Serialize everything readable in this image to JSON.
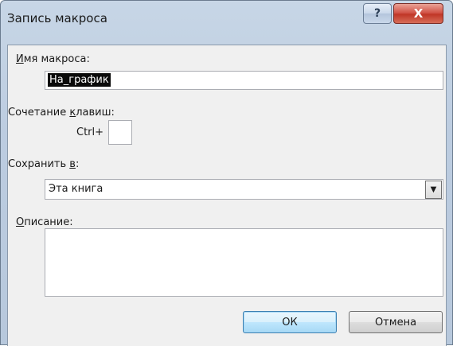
{
  "window": {
    "title": "Запись макроса",
    "help_label": "?",
    "close_label": "X"
  },
  "form": {
    "macro_name_label_pre": "",
    "macro_name_label_u": "И",
    "macro_name_label_post": "мя макроса:",
    "macro_name_value": "На_график",
    "shortcut_label_pre": "Сочетание ",
    "shortcut_label_u": "к",
    "shortcut_label_post": "лавиш:",
    "shortcut_prefix": "Ctrl+",
    "shortcut_value": "",
    "store_label_pre": "Сохранить ",
    "store_label_u": "в",
    "store_label_post": ":",
    "store_value": "Эта книга",
    "description_label_u": "О",
    "description_label_post": "писание:",
    "description_value": ""
  },
  "buttons": {
    "ok": "ОК",
    "cancel": "Отмена"
  },
  "icons": {
    "dropdown": "chevron-down-icon"
  }
}
